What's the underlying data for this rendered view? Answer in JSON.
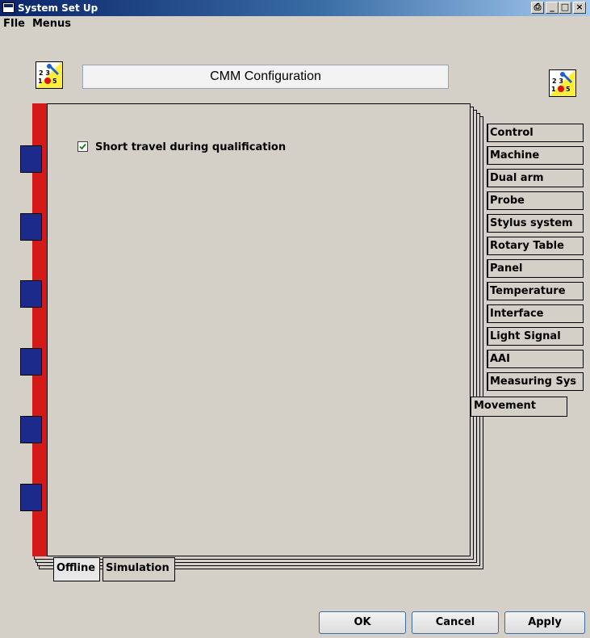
{
  "window": {
    "title": "System Set Up"
  },
  "menu": {
    "items": [
      "FIle",
      "Menus"
    ]
  },
  "header": {
    "title": "CMM Configuration"
  },
  "checkbox": {
    "label": "Short travel during qualification",
    "checked": true
  },
  "right_tabs": [
    "Control",
    "Machine",
    "Dual arm",
    "Probe",
    "Stylus system",
    "Rotary Table",
    "Panel",
    "Temperature",
    "Interface",
    "Light Signal",
    "AAI",
    "Measuring Sys"
  ],
  "active_right_tab": "Movement",
  "bottom_tabs": [
    "Offline",
    "Simulation"
  ],
  "buttons": {
    "ok": "OK",
    "cancel": "Cancel",
    "apply": "Apply"
  },
  "colors": {
    "spine": "#d41919",
    "ring": "#1c2a8c",
    "titlebar": "#0a246a"
  }
}
